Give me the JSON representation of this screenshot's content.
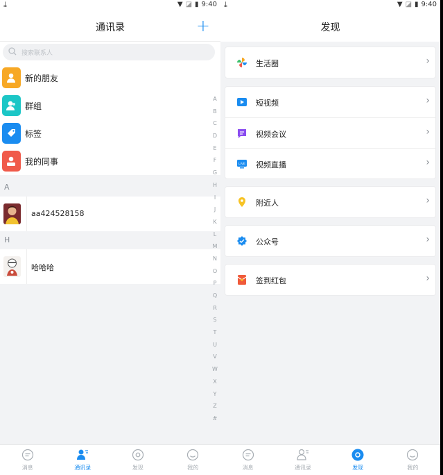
{
  "status": {
    "time": "9:40"
  },
  "left": {
    "title": "通讯录",
    "search_placeholder": "搜索联系人",
    "items": [
      {
        "label": "新的朋友",
        "color": "#f7a825"
      },
      {
        "label": "群组",
        "color": "#1cc6c6"
      },
      {
        "label": "标签",
        "color": "#1a8cf0"
      },
      {
        "label": "我的同事",
        "color": "#f05a4a"
      }
    ],
    "sections": [
      {
        "header": "A",
        "name": "aa424528158"
      },
      {
        "header": "H",
        "name": "哈哈哈"
      }
    ],
    "alphabet": [
      "A",
      "B",
      "C",
      "D",
      "E",
      "F",
      "G",
      "H",
      "I",
      "J",
      "K",
      "L",
      "M",
      "N",
      "O",
      "P",
      "Q",
      "R",
      "S",
      "T",
      "U",
      "V",
      "W",
      "X",
      "Y",
      "Z",
      "#"
    ]
  },
  "right": {
    "title": "发现",
    "groups": [
      [
        {
          "label": "生活圈",
          "icon": "pinwheel-icon"
        }
      ],
      [
        {
          "label": "短视频",
          "icon": "play-video-icon"
        },
        {
          "label": "视频会议",
          "icon": "meeting-icon"
        },
        {
          "label": "视频直播",
          "icon": "live-icon",
          "icon_text": "LIVE"
        }
      ],
      [
        {
          "label": "附近人",
          "icon": "location-pin-icon"
        }
      ],
      [
        {
          "label": "公众号",
          "icon": "verified-badge-icon"
        }
      ],
      [
        {
          "label": "签到红包",
          "icon": "red-envelope-icon"
        }
      ]
    ]
  },
  "tabs": [
    {
      "label": "消息",
      "icon": "chat-icon"
    },
    {
      "label": "通讯录",
      "icon": "contacts-icon"
    },
    {
      "label": "发现",
      "icon": "discover-icon"
    },
    {
      "label": "我的",
      "icon": "profile-icon"
    }
  ],
  "colors": {
    "accent": "#1a8cf0"
  }
}
